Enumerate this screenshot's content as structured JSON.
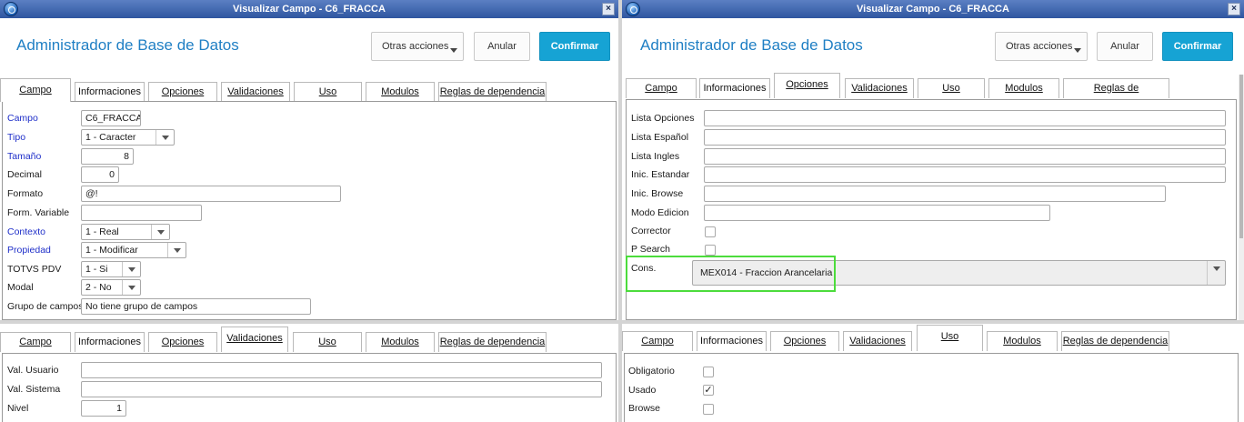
{
  "window": {
    "title": "Visualizar Campo - C6_FRACCA",
    "close": "×"
  },
  "app": {
    "title": "Administrador de Base de Datos"
  },
  "buttons": {
    "otras": "Otras acciones",
    "anular": "Anular",
    "confirmar": "Confirmar"
  },
  "tabs": {
    "campo": "Campo",
    "informaciones": "Informaciones",
    "opciones": "Opciones",
    "validaciones": "Validaciones",
    "uso": "Uso",
    "modulos": "Modulos",
    "reglas": "Reglas de dependencia"
  },
  "campo": {
    "campo_label": "Campo",
    "campo_value": "C6_FRACCA",
    "tipo_label": "Tipo",
    "tipo_value": "1 - Caracter",
    "tamano_label": "Tamaño",
    "tamano_value": "8",
    "decimal_label": "Decimal",
    "decimal_value": "0",
    "formato_label": "Formato",
    "formato_value": "@!",
    "formvar_label": "Form. Variable",
    "formvar_value": "",
    "contexto_label": "Contexto",
    "contexto_value": "1 - Real",
    "propiedad_label": "Propiedad",
    "propiedad_value": "1 - Modificar",
    "totvs_label": "TOTVS PDV",
    "totvs_value": "1 - Si",
    "modal_label": "Modal",
    "modal_value": "2 - No",
    "grupo_label": "Grupo de campos",
    "grupo_value": "No tiene grupo de campos"
  },
  "opciones": {
    "lista_opciones": "Lista Opciones",
    "lista_espanol": "Lista Español",
    "lista_ingles": "Lista Ingles",
    "inic_estandar": "Inic. Estandar",
    "inic_browse": "Inic. Browse",
    "modo_edicion": "Modo Edicion",
    "corrector": "Corrector",
    "p_search": "P Search",
    "cons_label": "Cons.",
    "cons_value": "MEX014 - Fraccion Arancelaria"
  },
  "validaciones": {
    "val_usuario": "Val. Usuario",
    "val_sistema": "Val. Sistema",
    "nivel_label": "Nivel",
    "nivel_value": "1"
  },
  "uso": {
    "obligatorio": "Obligatorio",
    "usado": "Usado",
    "usado_check": "✓",
    "browse": "Browse"
  },
  "colors": {
    "accent": "#16a3d4",
    "title_text": "#1f7fc4",
    "highlight": "#4cdc3c",
    "required_label": "#1f2fc9"
  }
}
